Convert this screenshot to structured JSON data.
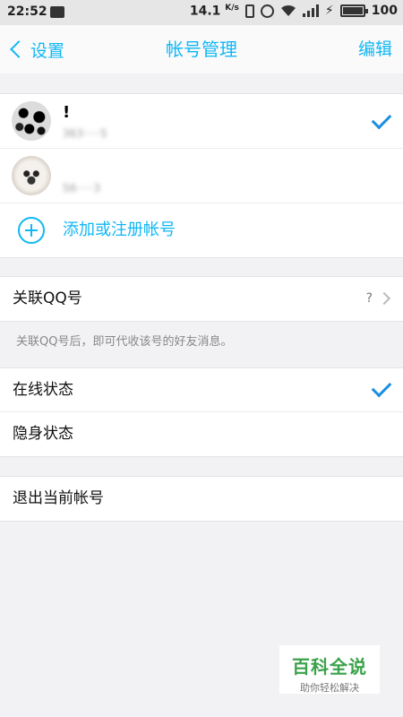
{
  "status_bar": {
    "time": "22:52",
    "speed_value": "14.1",
    "speed_unit": "K/s",
    "battery": "100",
    "icons": [
      "message-icon",
      "vibrate-icon",
      "alarm-icon",
      "wifi-icon",
      "signal-icon",
      "charging-icon",
      "battery-icon"
    ]
  },
  "navbar": {
    "back_label": "设置",
    "title": "帐号管理",
    "edit_label": "编辑"
  },
  "accounts": [
    {
      "nickname": "!",
      "qq_number": "363·····5",
      "selected": true
    },
    {
      "nickname": "",
      "qq_number": "56·····3",
      "selected": false
    }
  ],
  "add_account": {
    "label": "添加或注册帐号"
  },
  "linked_qq": {
    "label": "关联QQ号",
    "status": "?",
    "hint": "关联QQ号后，即可代收该号的好友消息。"
  },
  "status_options": [
    {
      "label": "在线状态",
      "selected": true
    },
    {
      "label": "隐身状态",
      "selected": false
    }
  ],
  "logout": {
    "label": "退出当前帐号"
  },
  "watermark": {
    "title": "百科全说",
    "subtitle": "助你轻松解决"
  },
  "colors": {
    "accent": "#12b7f5",
    "check": "#1a8fe0",
    "watermark": "#3aa24a"
  }
}
